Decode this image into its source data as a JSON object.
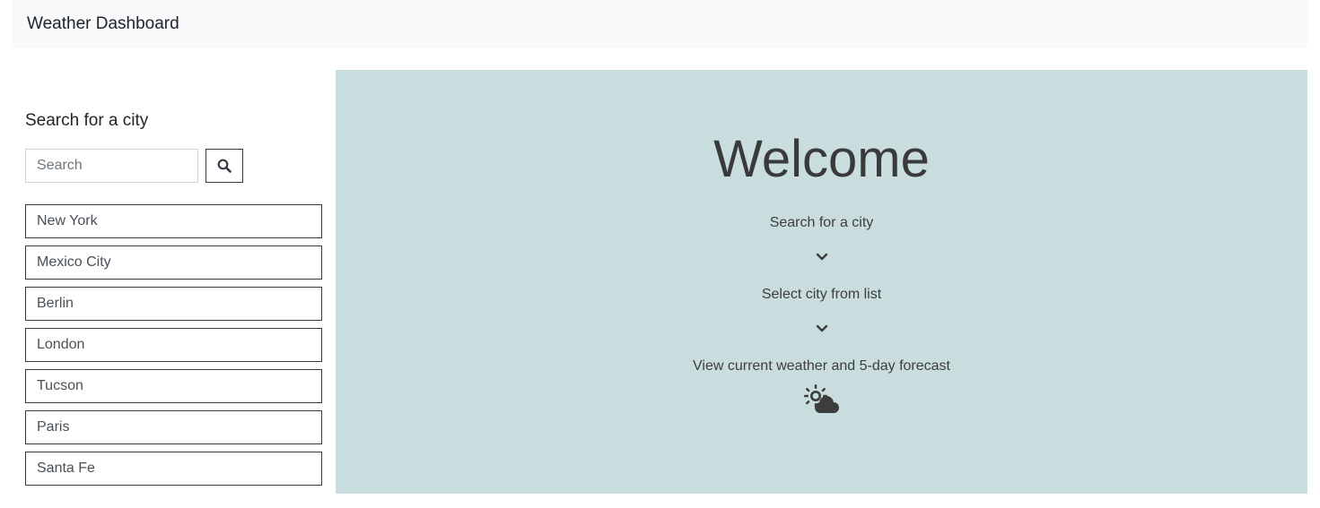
{
  "header": {
    "title": "Weather Dashboard"
  },
  "sidebar": {
    "heading": "Search for a city",
    "search": {
      "placeholder": "Search",
      "value": "",
      "button_icon": "search-icon"
    },
    "cities": [
      {
        "label": "New York"
      },
      {
        "label": "Mexico City"
      },
      {
        "label": "Berlin"
      },
      {
        "label": "London"
      },
      {
        "label": "Tucson"
      },
      {
        "label": "Paris"
      },
      {
        "label": "Santa Fe"
      }
    ]
  },
  "welcome": {
    "title": "Welcome",
    "steps": [
      "Search for a city",
      "Select city from list",
      "View current weather and 5-day forecast"
    ],
    "icons": [
      "chevron-down-icon",
      "sun-cloud-icon"
    ]
  },
  "colors": {
    "navbar_bg": "#f8f9fa",
    "panel_bg": "#c9dddf",
    "border_dark": "#343a40",
    "text": "#212529"
  }
}
